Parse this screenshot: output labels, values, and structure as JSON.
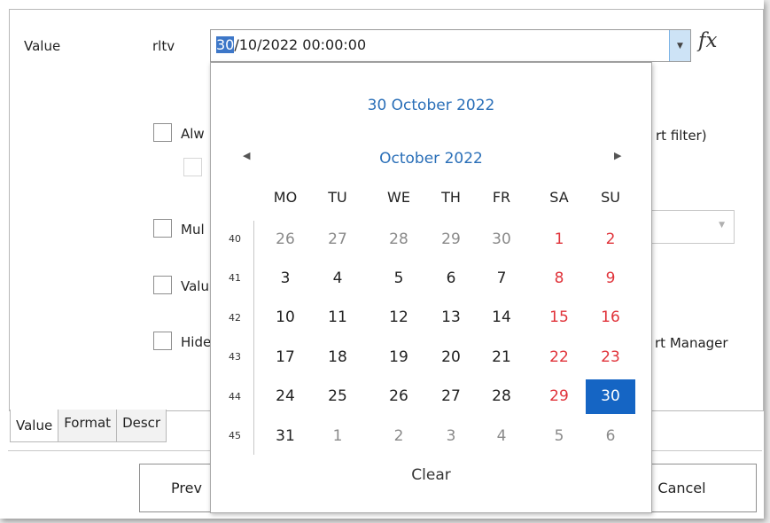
{
  "form": {
    "value_label": "Value",
    "field_name": "rltv",
    "date_value_selected": "30",
    "date_value_rest": "/10/2022 00:00:00",
    "fx_label": "fx",
    "option1_label": "Alw",
    "option1_tail": "rt filter)",
    "option2_label": "Mul",
    "option3_label": "Valu",
    "option4_label": "Hide",
    "option4_tail": "rt Manager"
  },
  "tabs": [
    "Value",
    "Format",
    "Descr"
  ],
  "buttons": {
    "prev_label": "Prev",
    "cancel_label": "Cancel"
  },
  "calendar": {
    "selected_date_text": "30 October 2022",
    "month_label": "October 2022",
    "nav_prev": "◀",
    "nav_next": "▶",
    "weekdays": [
      "MO",
      "TU",
      "WE",
      "TH",
      "FR",
      "SA",
      "SU"
    ],
    "weeks": [
      {
        "num": "40",
        "days": [
          [
            "26",
            "other"
          ],
          [
            "27",
            "other"
          ],
          [
            "28",
            "other"
          ],
          [
            "29",
            "other"
          ],
          [
            "30",
            "other"
          ],
          [
            "1",
            "wkend"
          ],
          [
            "2",
            "wkend"
          ]
        ]
      },
      {
        "num": "41",
        "days": [
          [
            "3",
            ""
          ],
          [
            "4",
            ""
          ],
          [
            "5",
            ""
          ],
          [
            "6",
            ""
          ],
          [
            "7",
            ""
          ],
          [
            "8",
            "wkend"
          ],
          [
            "9",
            "wkend"
          ]
        ]
      },
      {
        "num": "42",
        "days": [
          [
            "10",
            ""
          ],
          [
            "11",
            ""
          ],
          [
            "12",
            ""
          ],
          [
            "13",
            ""
          ],
          [
            "14",
            ""
          ],
          [
            "15",
            "wkend"
          ],
          [
            "16",
            "wkend"
          ]
        ]
      },
      {
        "num": "43",
        "days": [
          [
            "17",
            ""
          ],
          [
            "18",
            ""
          ],
          [
            "19",
            ""
          ],
          [
            "20",
            ""
          ],
          [
            "21",
            ""
          ],
          [
            "22",
            "wkend"
          ],
          [
            "23",
            "wkend"
          ]
        ]
      },
      {
        "num": "44",
        "days": [
          [
            "24",
            ""
          ],
          [
            "25",
            ""
          ],
          [
            "26",
            ""
          ],
          [
            "27",
            ""
          ],
          [
            "28",
            ""
          ],
          [
            "29",
            "wkend"
          ],
          [
            "30",
            "selected"
          ]
        ]
      },
      {
        "num": "45",
        "days": [
          [
            "31",
            ""
          ],
          [
            "1",
            "other"
          ],
          [
            "2",
            "other"
          ],
          [
            "3",
            "other"
          ],
          [
            "4",
            "other"
          ],
          [
            "5",
            "other"
          ],
          [
            "6",
            "other"
          ]
        ]
      }
    ],
    "clear_label": "Clear"
  },
  "colors": {
    "accent": "#2a6fb8",
    "selected_bg": "#1565c4",
    "weekend": "#e0333a"
  }
}
